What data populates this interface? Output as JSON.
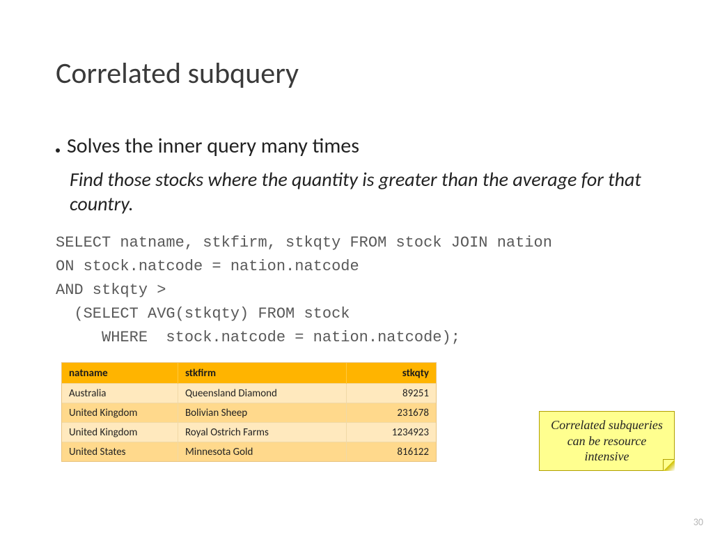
{
  "title": "Correlated subquery",
  "bullet": "Solves the inner query many times",
  "subtext": "Find those stocks where the quantity is greater than the average for that country.",
  "sql": "SELECT natname, stkfirm, stkqty FROM stock JOIN nation\nON stock.natcode = nation.natcode\nAND stkqty >\n  (SELECT AVG(stkqty) FROM stock\n     WHERE  stock.natcode = nation.natcode);",
  "table": {
    "headers": [
      "natname",
      "stkfirm",
      "stkqty"
    ],
    "rows": [
      [
        "Australia",
        "Queensland Diamond",
        "89251"
      ],
      [
        "United Kingdom",
        "Bolivian Sheep",
        "231678"
      ],
      [
        "United Kingdom",
        "Royal Ostrich Farms",
        "1234923"
      ],
      [
        "United States",
        "Minnesota Gold",
        "816122"
      ]
    ]
  },
  "sticky": "Correlated subqueries can be resource intensive",
  "page_number": "30"
}
